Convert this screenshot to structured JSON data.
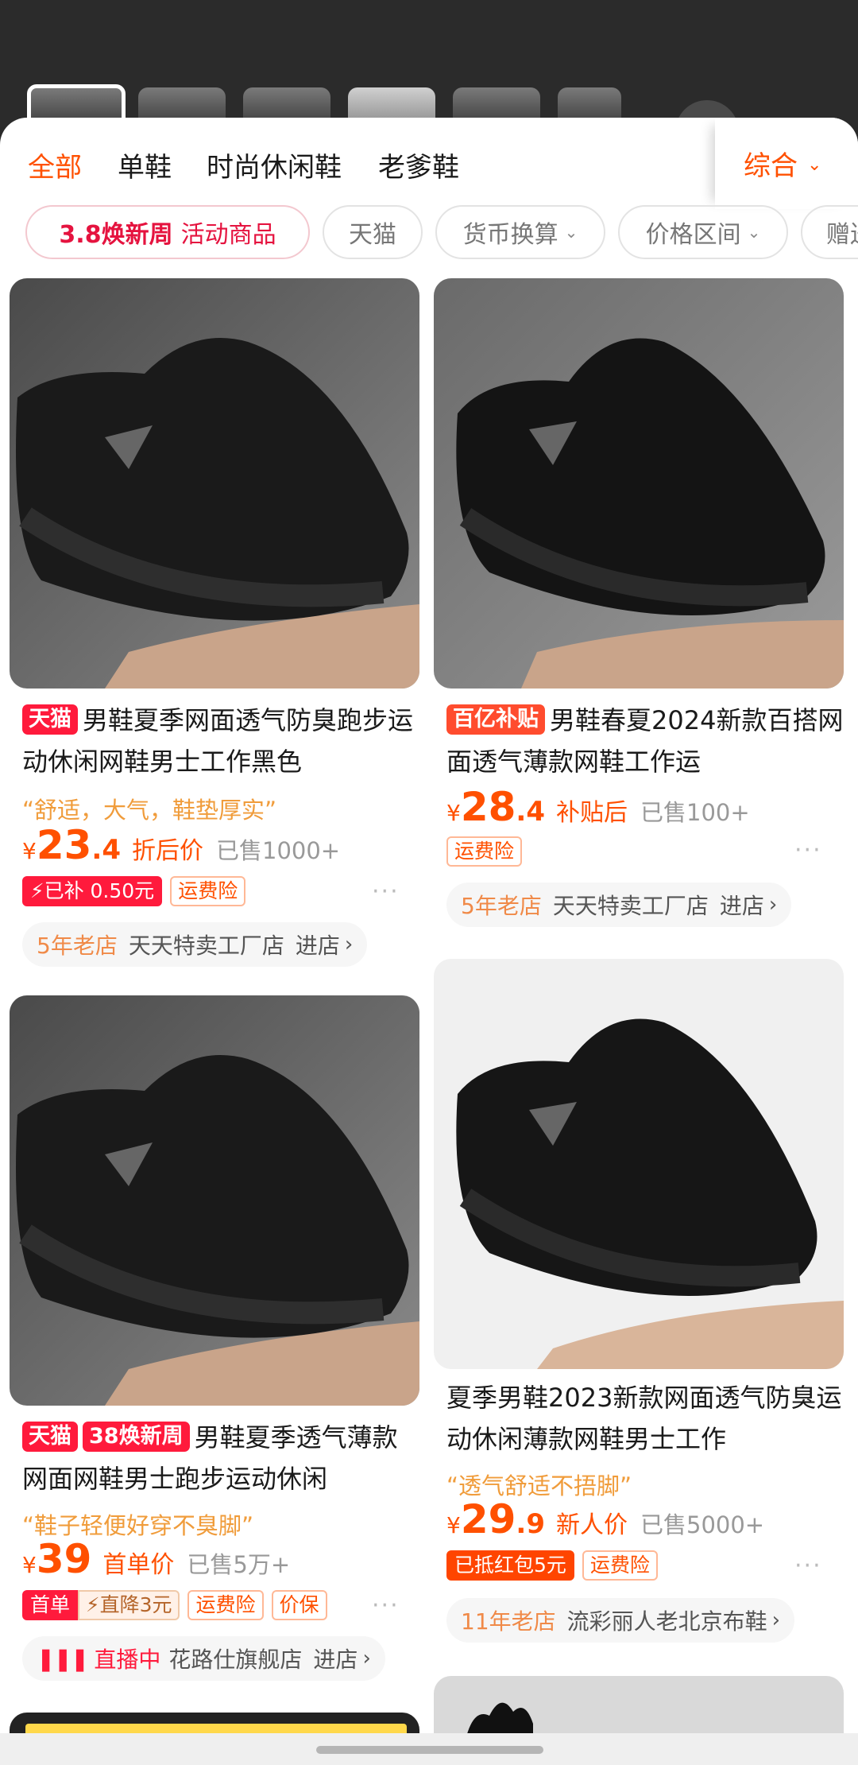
{
  "categories": {
    "tabs": [
      "全部",
      "单鞋",
      "时尚休闲鞋",
      "老爹鞋"
    ],
    "active_index": 0,
    "sort_label": "综合",
    "sort_chevron": "chevron-down-icon"
  },
  "filters": {
    "promo_a": "3.8焕新周",
    "promo_b": "活动商品",
    "chips": [
      "天猫",
      "货币换算",
      "价格区间",
      "赠送"
    ]
  },
  "products": [
    {
      "badges": [
        "天猫"
      ],
      "title": "男鞋夏季网面透气防臭跑步运动休闲网鞋男士工作黑色",
      "quote": "“舒适，大气，鞋垫厚实”",
      "price_int": "23",
      "price_dec": ".4",
      "price_label": "折后价",
      "sold": "已售1000+",
      "tags": [
        "已补 0.50元",
        "运费险"
      ],
      "shop_age": "5年老店",
      "shop_name": "天天特卖工厂店",
      "enter": "进店"
    },
    {
      "badges": [
        "百亿补贴"
      ],
      "title": "男鞋春夏2024新款百搭网面透气薄款网鞋工作运",
      "quote": "",
      "price_int": "28",
      "price_dec": ".4",
      "price_label": "补贴后",
      "sold": "已售100+",
      "tags": [
        "运费险"
      ],
      "shop_age": "5年老店",
      "shop_name": "天天特卖工厂店",
      "enter": "进店"
    },
    {
      "badges": [
        "天猫",
        "38焕新周"
      ],
      "title": "男鞋夏季透气薄款网面网鞋男士跑步运动休闲",
      "quote": "“鞋子轻便好穿不臭脚”",
      "price_int": "39",
      "price_dec": "",
      "price_label": "首单价",
      "sold": "已售5万+",
      "tags": [
        "首单",
        "直降3元",
        "运费险",
        "价保"
      ],
      "shop_age": "直播中",
      "shop_name": "花路仕旗舰店",
      "enter": "进店"
    },
    {
      "badges": [],
      "title": "夏季男鞋2023新款网面透气防臭运动休闲薄款网鞋男士工作",
      "quote": "“透气舒适不捂脚”",
      "price_int": "29",
      "price_dec": ".9",
      "price_label": "新人价",
      "sold": "已售5000+",
      "tags": [
        "已抵红包5元",
        "运费险"
      ],
      "shop_age": "11年老店",
      "shop_name": "流彩丽人老北京布鞋",
      "enter": "进店"
    }
  ],
  "currency": "¥",
  "colors": {
    "accent": "#ff5000",
    "tmall_red": "#ff1a3c",
    "quote": "#f09c3b"
  }
}
